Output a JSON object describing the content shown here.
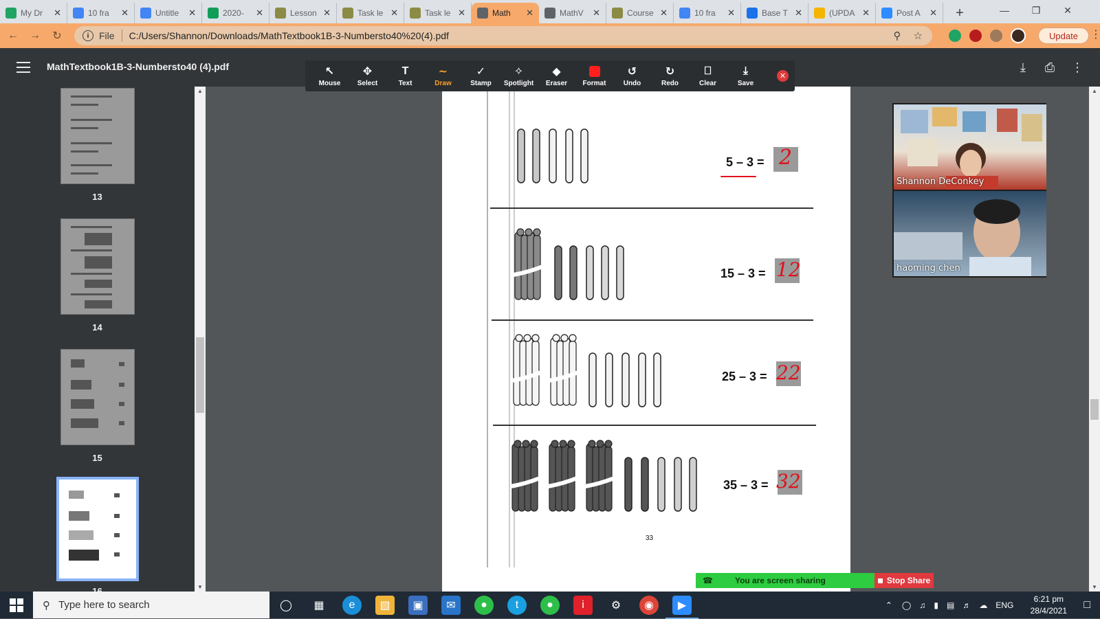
{
  "browser": {
    "tabs": [
      {
        "title": "My Dr",
        "icon": "google-drive-icon",
        "color": "#1fa463"
      },
      {
        "title": "10 fra",
        "icon": "google-docs-icon",
        "color": "#4285f4"
      },
      {
        "title": "Untitle",
        "icon": "google-docs-icon",
        "color": "#4285f4"
      },
      {
        "title": "2020-",
        "icon": "google-sheets-icon",
        "color": "#0f9d58"
      },
      {
        "title": "Lesson",
        "icon": "task-doc-icon",
        "color": "#8b8b45"
      },
      {
        "title": "Task le",
        "icon": "task-doc-icon",
        "color": "#8b8b45"
      },
      {
        "title": "Task le",
        "icon": "task-doc-icon",
        "color": "#8b8b45"
      },
      {
        "title": "Math",
        "icon": "globe-icon",
        "color": "#5f6368"
      },
      {
        "title": "MathV",
        "icon": "globe-icon",
        "color": "#5f6368"
      },
      {
        "title": "Course",
        "icon": "task-doc-icon",
        "color": "#8b8b45"
      },
      {
        "title": "10 fra",
        "icon": "google-docs-icon",
        "color": "#4285f4"
      },
      {
        "title": "Base T",
        "icon": "base-ten-icon",
        "color": "#1a73e8"
      },
      {
        "title": "(UPDA",
        "icon": "update-doc-icon",
        "color": "#f4b400"
      },
      {
        "title": "Post A",
        "icon": "zoom-icon",
        "color": "#2d8cff"
      }
    ],
    "active_tab_index": 7,
    "address_label": "File",
    "url": "C:/Users/Shannon/Downloads/MathTextbook1B-3-Numbersto40%20(4).pdf",
    "update_label": "Update"
  },
  "pdf": {
    "title": "MathTextbook1B-3-Numbersto40 (4).pdf",
    "thumbnails": [
      {
        "page": "13"
      },
      {
        "page": "14"
      },
      {
        "page": "15"
      },
      {
        "page": "16"
      }
    ],
    "page_number_printed": "33",
    "problems": [
      {
        "expression": "5 – 3 =",
        "answer": "2"
      },
      {
        "expression": "15 – 3 =",
        "answer": "12"
      },
      {
        "expression": "25 – 3 =",
        "answer": "22"
      },
      {
        "expression": "35 – 3 =",
        "answer": "32"
      }
    ]
  },
  "annotation_toolbar": {
    "tools": [
      {
        "label": "Mouse",
        "icon": "cursor-icon"
      },
      {
        "label": "Select",
        "icon": "move-icon"
      },
      {
        "label": "Text",
        "icon": "text-icon"
      },
      {
        "label": "Draw",
        "icon": "draw-icon"
      },
      {
        "label": "Stamp",
        "icon": "checkmark-icon"
      },
      {
        "label": "Spotlight",
        "icon": "spotlight-icon"
      },
      {
        "label": "Eraser",
        "icon": "eraser-icon"
      },
      {
        "label": "Format",
        "icon": "format-color-icon"
      },
      {
        "label": "Undo",
        "icon": "undo-icon"
      },
      {
        "label": "Redo",
        "icon": "redo-icon"
      },
      {
        "label": "Clear",
        "icon": "trash-icon"
      },
      {
        "label": "Save",
        "icon": "save-icon"
      }
    ],
    "active_tool": "Draw",
    "accent_color": "#f7a12a",
    "format_color": "#ff1f1f"
  },
  "video": {
    "participants": [
      {
        "name": "Shannon DeConkey"
      },
      {
        "name": "haoming chen"
      }
    ]
  },
  "screen_share": {
    "status": "You are screen sharing",
    "stop_label": "Stop Share"
  },
  "taskbar": {
    "search_placeholder": "Type here to search",
    "language": "ENG",
    "time": "6:21 pm",
    "date": "28/4/2021"
  }
}
